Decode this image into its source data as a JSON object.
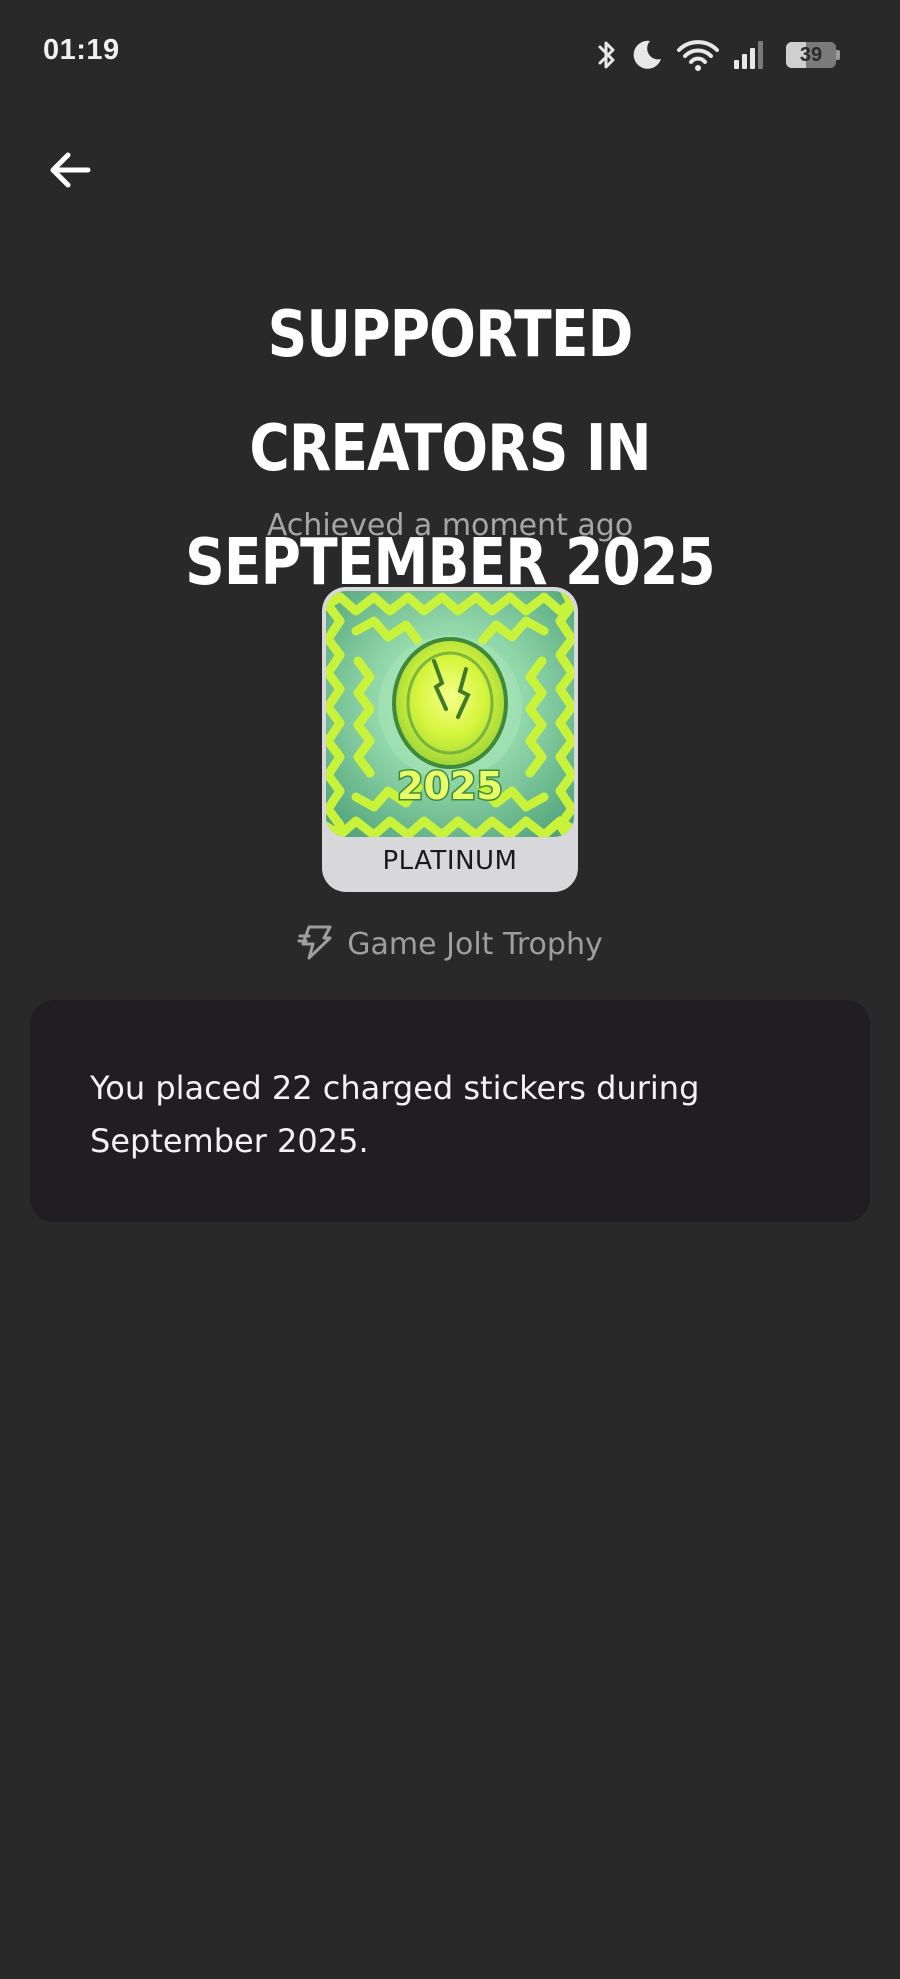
{
  "status_bar": {
    "time": "01:19",
    "battery_level": "39",
    "battery_percent": 39,
    "icons": [
      "bluetooth-icon",
      "do-not-disturb-moon-icon",
      "wifi-icon",
      "cellular-signal-icon",
      "battery-icon"
    ]
  },
  "navigation": {
    "back_icon": "arrow-left-icon"
  },
  "trophy": {
    "title_line1": "SUPPORTED CREATORS IN",
    "title_line2": "SEPTEMBER 2025",
    "achieved": "Achieved a moment ago",
    "tier": "PLATINUM",
    "image_year": "2025",
    "type_icon": "game-jolt-logo-icon",
    "type_label": "Game Jolt Trophy",
    "description": "You placed 22 charged stickers during September 2025."
  },
  "colors": {
    "background": "#292929",
    "card_background": "#201e22",
    "tier_plate": "#d8d8da",
    "trophy_green": "#c6f23a",
    "muted_text": "#a6a6a6"
  }
}
